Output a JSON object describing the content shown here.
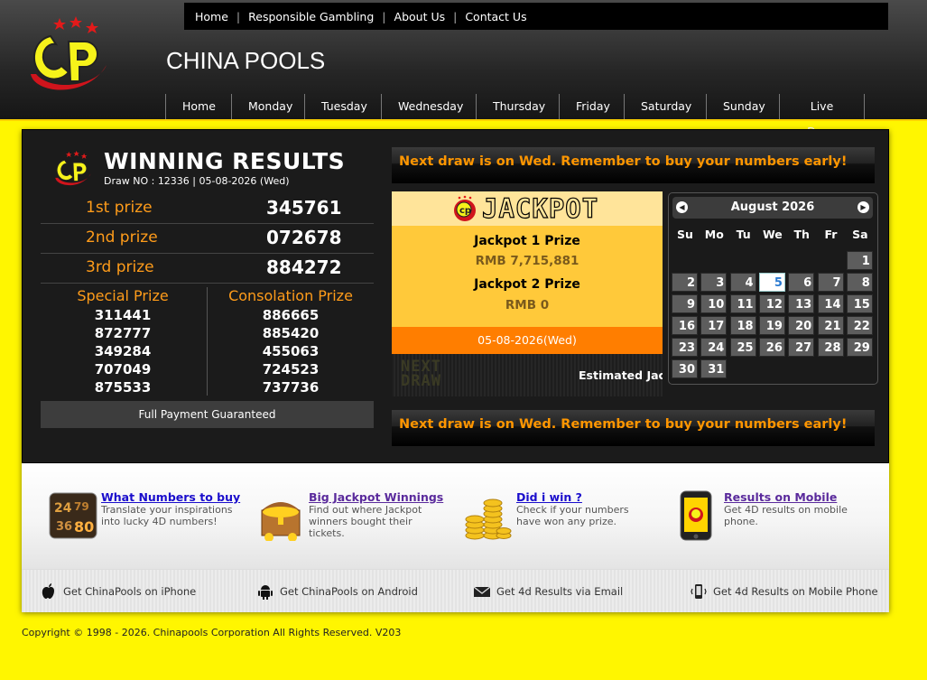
{
  "topnav": [
    "Home",
    "Responsible Gambling",
    "About Us",
    "Contact Us"
  ],
  "site_title": "CHINA POOLS",
  "daynav": [
    "Home",
    "Monday",
    "Tuesday",
    "Wednesday",
    "Thursday",
    "Friday",
    "Saturday",
    "Sunday",
    "Live Draw"
  ],
  "results": {
    "title": "WINNING RESULTS",
    "draw_no": "Draw NO : 12336 | 05-08-2026 (Wed)",
    "prizes": [
      {
        "label": "1st prize",
        "value": "345761"
      },
      {
        "label": "2nd prize",
        "value": "072678"
      },
      {
        "label": "3rd prize",
        "value": "884272"
      }
    ],
    "special_title": "Special Prize",
    "special": [
      "311441",
      "872777",
      "349284",
      "707049",
      "875533"
    ],
    "consolation_title": "Consolation Prize",
    "consolation": [
      "886665",
      "885420",
      "455063",
      "724523",
      "737736"
    ],
    "guarantee": "Full Payment Guaranteed"
  },
  "next_draw_msg": "Next draw is on Wed. Remember to buy your numbers early!",
  "jackpot": {
    "word": "JACKPOT",
    "jp1_label": "Jackpot 1 Prize",
    "jp1_value": "RMB 7,715,881",
    "jp2_label": "Jackpot 2 Prize",
    "jp2_value": "RMB 0",
    "date": "05-08-2026(Wed)",
    "led_line1": "NEXT",
    "led_line2": "DRAW",
    "estimated": "Estimated Jac"
  },
  "calendar": {
    "month": "August 2026",
    "prev": "◀",
    "next": "▶",
    "dow": [
      "Su",
      "Mo",
      "Tu",
      "We",
      "Th",
      "Fr",
      "Sa"
    ],
    "first_weekday": 6,
    "days": 31,
    "today": 5
  },
  "features": [
    {
      "title": "What Numbers to buy",
      "desc": "Translate your inspirations into lucky 4D numbers!",
      "icon": "dice-numbers-icon",
      "visited": false
    },
    {
      "title": "Big Jackpot Winnings",
      "desc": "Find out where Jackpot winners bought their tickets.",
      "icon": "treasure-chest-icon",
      "visited": true
    },
    {
      "title": "Did i win ?",
      "desc": "Check if your numbers have won any prize.",
      "icon": "gold-coins-icon",
      "visited": false
    },
    {
      "title": "Results on Mobile",
      "desc": "Get 4D results on mobile phone.",
      "icon": "mobile-phone-icon",
      "visited": true
    }
  ],
  "apps": [
    {
      "label": "Get ChinaPools on iPhone",
      "icon": "apple-icon"
    },
    {
      "label": "Get ChinaPools on Android",
      "icon": "android-icon"
    },
    {
      "label": "Get 4d Results via Email",
      "icon": "envelope-icon"
    },
    {
      "label": "Get 4d Results on Mobile Phone",
      "icon": "mobile-vibrate-icon"
    }
  ],
  "footer": "Copyright © 1998 - 2026. Chinapools Corporation All Rights Reserved. V203",
  "colors": {
    "brand_yellow": "#fff600",
    "accent_orange": "#ff9600",
    "prize_orange": "#ff9c1a"
  }
}
